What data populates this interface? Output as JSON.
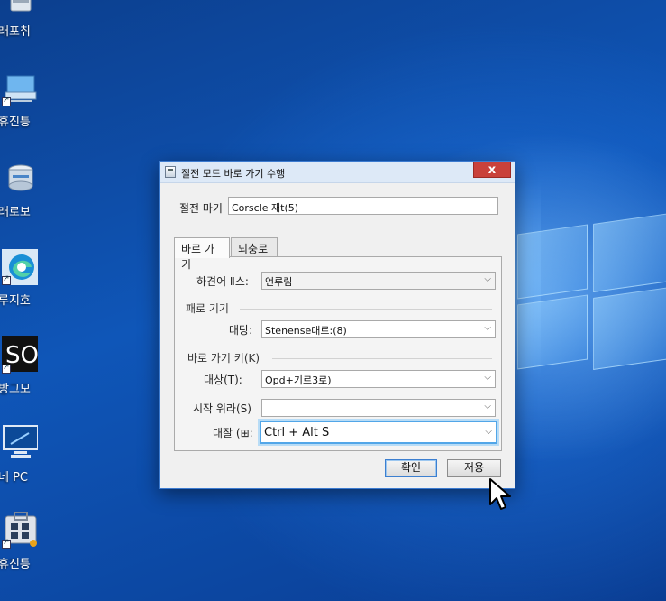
{
  "desktop": {
    "icons": [
      {
        "label": "래포취",
        "icon": "recycle-bin-icon"
      },
      {
        "label": "휴진틍",
        "icon": "network-computer-icon"
      },
      {
        "label": "래로보",
        "icon": "server-disk-icon"
      },
      {
        "label": "루지호",
        "icon": "edge-browser-icon"
      },
      {
        "label": "방그모",
        "icon": "sonos-app-icon"
      },
      {
        "label": "네 PC",
        "icon": "this-pc-monitor-icon"
      },
      {
        "label": "휴진틍",
        "icon": "store-app-icon"
      }
    ]
  },
  "dialog": {
    "title": "절전 모드 바로 가기 수행",
    "close_glyph": "x",
    "name_label": "절전 마기",
    "name_value": "Corscle 재t(5)",
    "tabs": [
      "바로 가기",
      "되충로"
    ],
    "fields": {
      "target_type_label": "하견어 Ⅱ스:",
      "target_type_value": "언루림",
      "group1_label": "패로 기기",
      "target_label": "대탕:",
      "target_value": "Stenense대르:(8)",
      "group2_label": "바로 가기 키(K)",
      "subject_label": "대상(T):",
      "subject_value": "Opd+기르3로)",
      "start_label": "시작 위라(S)",
      "start_value": "",
      "hotkey_label": "대잘 (⊞:",
      "hotkey_value": "Ctrl + Alt S"
    },
    "buttons": {
      "ok": "확인",
      "apply": "저용"
    }
  },
  "colors": {
    "desktop_blue": "#0f56b8",
    "close_red": "#c9413a",
    "focus_blue": "#52a6e8"
  }
}
